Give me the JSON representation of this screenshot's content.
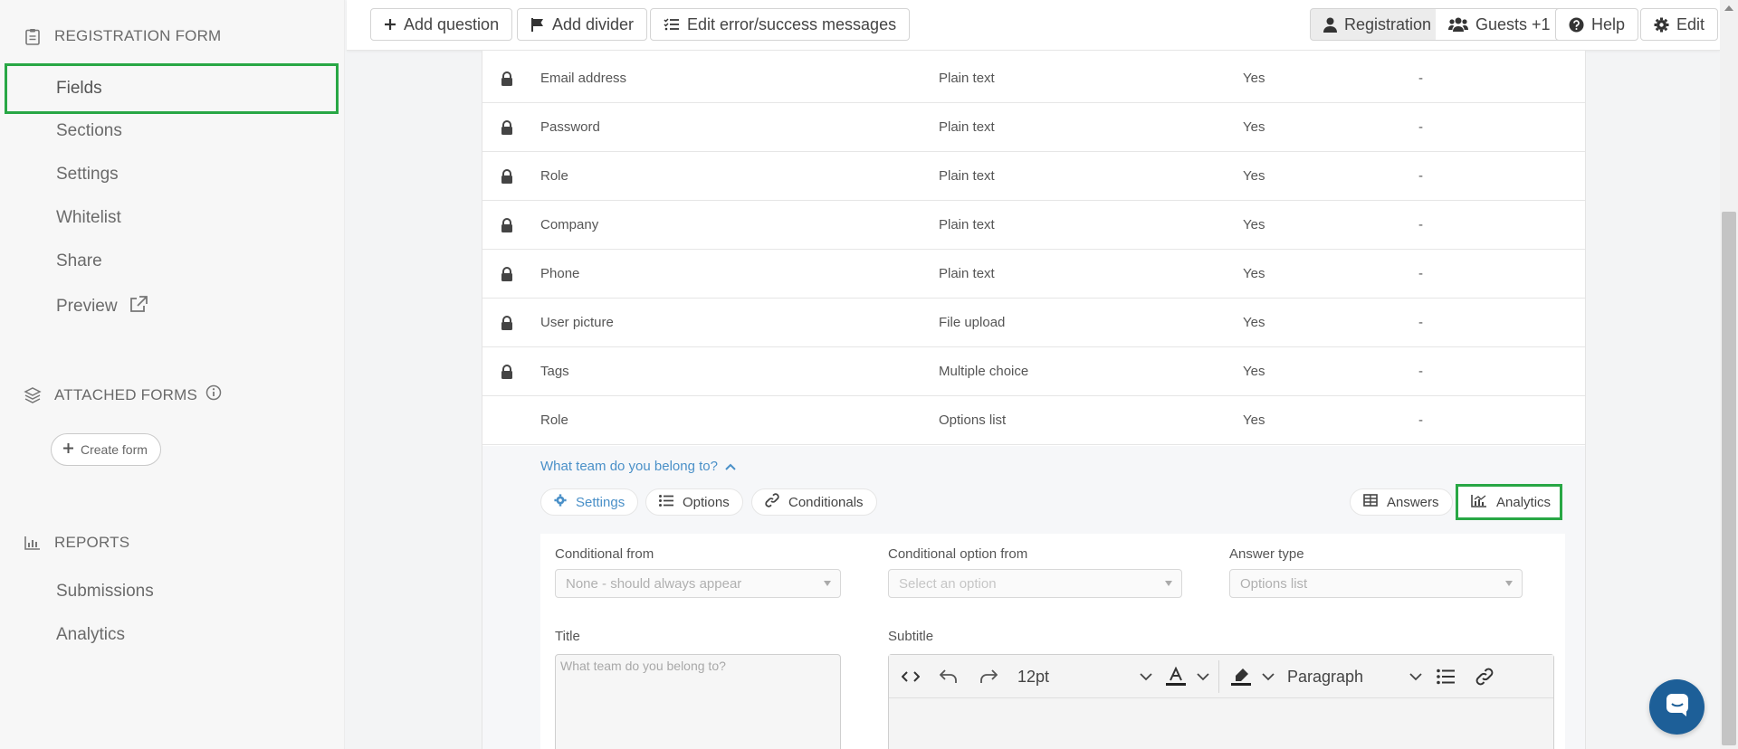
{
  "sidebar": {
    "registration_heading": "REGISTRATION FORM",
    "items": [
      {
        "label": "Fields",
        "active": true
      },
      {
        "label": "Sections"
      },
      {
        "label": "Settings"
      },
      {
        "label": "Whitelist"
      },
      {
        "label": "Share"
      },
      {
        "label": "Preview"
      }
    ],
    "attached_heading": "ATTACHED FORMS",
    "create_form_label": "Create form",
    "reports_heading": "REPORTS",
    "report_items": [
      {
        "label": "Submissions"
      },
      {
        "label": "Analytics"
      }
    ]
  },
  "toolbar": {
    "add_question": "Add question",
    "add_divider": "Add divider",
    "edit_messages": "Edit error/success messages",
    "registration": "Registration",
    "guests": "Guests +1",
    "help": "Help",
    "edit": "Edit"
  },
  "fields": [
    {
      "name": "Email address",
      "type": "Plain text",
      "required": "Yes",
      "extra": "-",
      "locked": true
    },
    {
      "name": "Password",
      "type": "Plain text",
      "required": "Yes",
      "extra": "-",
      "locked": true
    },
    {
      "name": "Role",
      "type": "Plain text",
      "required": "Yes",
      "extra": "-",
      "locked": true
    },
    {
      "name": "Company",
      "type": "Plain text",
      "required": "Yes",
      "extra": "-",
      "locked": true
    },
    {
      "name": "Phone",
      "type": "Plain text",
      "required": "Yes",
      "extra": "-",
      "locked": true
    },
    {
      "name": "User picture",
      "type": "File upload",
      "required": "Yes",
      "extra": "-",
      "locked": true
    },
    {
      "name": "Tags",
      "type": "Multiple choice",
      "required": "Yes",
      "extra": "-",
      "locked": true
    },
    {
      "name": "Role",
      "type": "Options list",
      "required": "Yes",
      "extra": "-",
      "locked": false
    }
  ],
  "expanded": {
    "question": "What team do you belong to?",
    "tabs": {
      "settings": "Settings",
      "options": "Options",
      "conditionals": "Conditionals",
      "answers": "Answers",
      "analytics": "Analytics"
    },
    "conditional_from": {
      "label": "Conditional from",
      "value": "None - should always appear"
    },
    "conditional_option": {
      "label": "Conditional option from",
      "placeholder": "Select an option"
    },
    "answer_type": {
      "label": "Answer type",
      "value": "Options list"
    },
    "title": {
      "label": "Title",
      "placeholder": "What team do you belong to?"
    },
    "subtitle": {
      "label": "Subtitle"
    },
    "editor": {
      "font_size": "12pt",
      "block_format": "Paragraph"
    }
  },
  "colors": {
    "highlight": "#28a745",
    "link": "#4a90c8",
    "chat": "#1d5f98"
  }
}
